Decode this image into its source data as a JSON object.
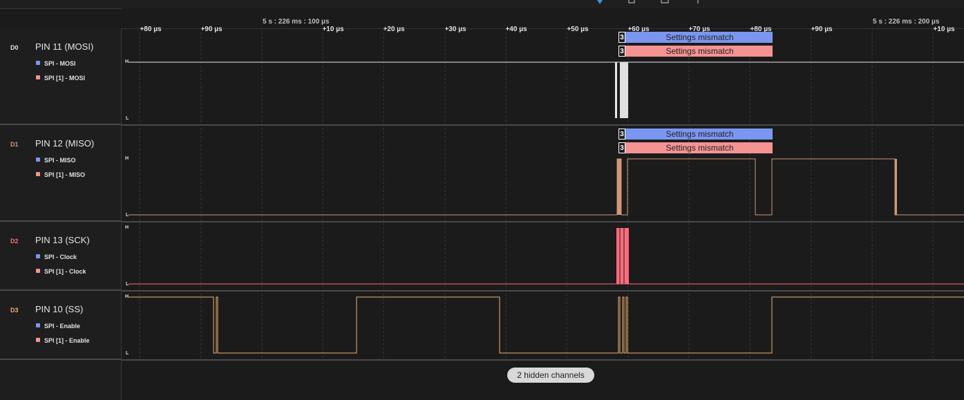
{
  "colors": {
    "bg": "#1b1b1b",
    "ch0": "#e8e8e8",
    "ch1": "#d0977a",
    "ch2": "#ff6b7c",
    "ch3": "#f0b070",
    "analyzer_a": "#7b96f0",
    "analyzer_b": "#f59393"
  },
  "toolbar": {
    "icons": [
      "play-icon",
      "stop-icon",
      "capture-icon",
      "pin-icon"
    ]
  },
  "timeline": {
    "timestamp_left": "5 s : 226 ms : 100 µs",
    "timestamp_right": "5 s : 226 ms : 200 µs",
    "ticks": [
      "+80 µs",
      "+90 µs",
      "+10 µs",
      "+20 µs",
      "+30 µs",
      "+40 µs",
      "+50 µs",
      "+60 µs",
      "+70 µs",
      "+80 µs",
      "+90 µs",
      "+10 µs"
    ]
  },
  "channels": [
    {
      "index": "D0",
      "name": "PIN 11 (MOSI)",
      "analyzers": [
        "SPI - MOSI",
        "SPI [1] - MOSI"
      ],
      "high": "H",
      "low": "L",
      "frames": [
        {
          "num": "3",
          "label": "Settings mismatch"
        },
        {
          "num": "3",
          "label": "Settings mismatch"
        }
      ]
    },
    {
      "index": "D1",
      "name": "PIN 12 (MISO)",
      "analyzers": [
        "SPI - MISO",
        "SPI [1] - MISO"
      ],
      "high": "H",
      "low": "L",
      "frames": [
        {
          "num": "3",
          "label": "Settings mismatch"
        },
        {
          "num": "3",
          "label": "Settings mismatch"
        }
      ]
    },
    {
      "index": "D2",
      "name": "PIN 13 (SCK)",
      "analyzers": [
        "SPI - Clock",
        "SPI [1] - Clock"
      ],
      "high": "H",
      "low": "L"
    },
    {
      "index": "D3",
      "name": "PIN 10 (SS)",
      "analyzers": [
        "SPI - Enable",
        "SPI [1] - Enable"
      ],
      "high": "H",
      "low": "L"
    }
  ],
  "hidden_channels_label": "2 hidden channels"
}
